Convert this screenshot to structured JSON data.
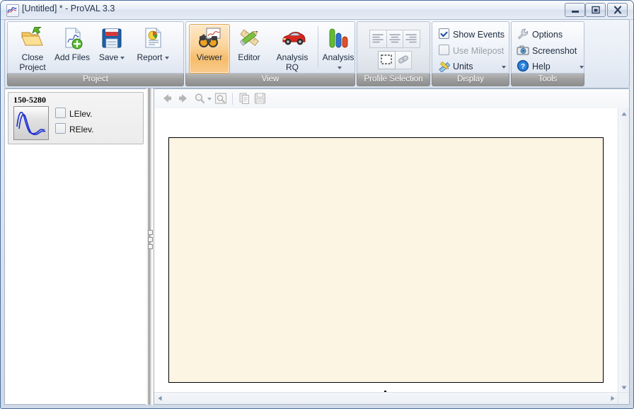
{
  "window": {
    "title": "[Untitled] * - ProVAL 3.3",
    "app_icon": "provAL-curve-icon",
    "minimize_label": "Minimize",
    "maximize_label": "Restore",
    "close_label": "Close"
  },
  "ribbon": {
    "groups": [
      {
        "caption": "Project",
        "enabled": true,
        "buttons": [
          {
            "label": "Close Project",
            "icon": "open-folder-icon",
            "has_menu": false,
            "enabled": true
          },
          {
            "label": "Add Files",
            "icon": "add-document-icon",
            "has_menu": false,
            "enabled": true
          },
          {
            "label": "Save",
            "icon": "floppy-disk-icon",
            "has_menu": true,
            "enabled": true
          },
          {
            "label": "Report",
            "icon": "report-chart-icon",
            "has_menu": true,
            "enabled": true
          }
        ]
      },
      {
        "caption": "View",
        "enabled": true,
        "buttons": [
          {
            "label": "Viewer",
            "icon": "binoculars-icon",
            "has_menu": false,
            "enabled": true,
            "selected": true
          },
          {
            "label": "Editor",
            "icon": "pencil-ruler-icon",
            "has_menu": false,
            "enabled": true
          },
          {
            "label": "Analysis RQ",
            "icon": "red-car-icon",
            "has_menu": false,
            "enabled": true
          },
          {
            "label": "Analysis",
            "icon": "bar-chart-icon",
            "has_menu": true,
            "enabled": true
          }
        ]
      },
      {
        "caption": "Profile Selection",
        "enabled": false,
        "tools": [
          {
            "icon": "align-left-icon",
            "enabled": false
          },
          {
            "icon": "align-center-icon",
            "enabled": false
          },
          {
            "icon": "align-right-icon",
            "enabled": false
          },
          {
            "icon": "marquee-select-icon",
            "enabled": false
          },
          {
            "icon": "eraser-icon",
            "enabled": false
          }
        ]
      },
      {
        "caption": "Display",
        "enabled": true,
        "rows": [
          {
            "label": "Show Events",
            "control": "checkbox",
            "checked": true,
            "enabled": true
          },
          {
            "label": "Use Milepost",
            "control": "checkbox",
            "checked": false,
            "enabled": false
          },
          {
            "label": "Units",
            "control": "menu",
            "icon": "ruler-pencil-icon",
            "has_menu": true,
            "enabled": true
          }
        ]
      },
      {
        "caption": "Tools",
        "enabled": true,
        "rows": [
          {
            "label": "Options",
            "icon": "wrench-icon",
            "has_menu": false,
            "enabled": true
          },
          {
            "label": "Screenshot",
            "icon": "camera-icon",
            "has_menu": false,
            "enabled": true
          },
          {
            "label": "Help",
            "icon": "help-question-icon",
            "has_menu": true,
            "enabled": true
          }
        ]
      }
    ]
  },
  "sidebar": {
    "profile": {
      "title": "150-5280",
      "thumbnail_icon": "profile-curve-thumbnail",
      "channels": [
        {
          "label": "LElev.",
          "checked": false
        },
        {
          "label": "RElev.",
          "checked": false
        }
      ]
    }
  },
  "viewer": {
    "toolbar": [
      {
        "icon": "back-arrow-icon",
        "enabled": false
      },
      {
        "icon": "forward-arrow-icon",
        "enabled": false
      },
      {
        "icon": "zoom-icon",
        "enabled": false,
        "has_menu": true
      },
      {
        "icon": "zoom-region-icon",
        "enabled": false
      },
      {
        "icon": "copy-icon",
        "enabled": false
      },
      {
        "icon": "save-image-icon",
        "enabled": false
      }
    ],
    "canvas": {
      "content": "",
      "background_color": "#fdf5e3",
      "border_color": "#000000"
    },
    "scrollbars": {
      "vertical_up_icon": "scroll-up-arrow",
      "vertical_down_icon": "scroll-down-arrow",
      "horizontal_left_icon": "scroll-left-arrow",
      "horizontal_right_icon": "scroll-right-arrow"
    }
  },
  "colors": {
    "selected_button": "#f6bc6a",
    "canvas_cream": "#fdf5e3",
    "group_caption": "#9d9d9d",
    "profile_curve": "#1d2fd0"
  }
}
